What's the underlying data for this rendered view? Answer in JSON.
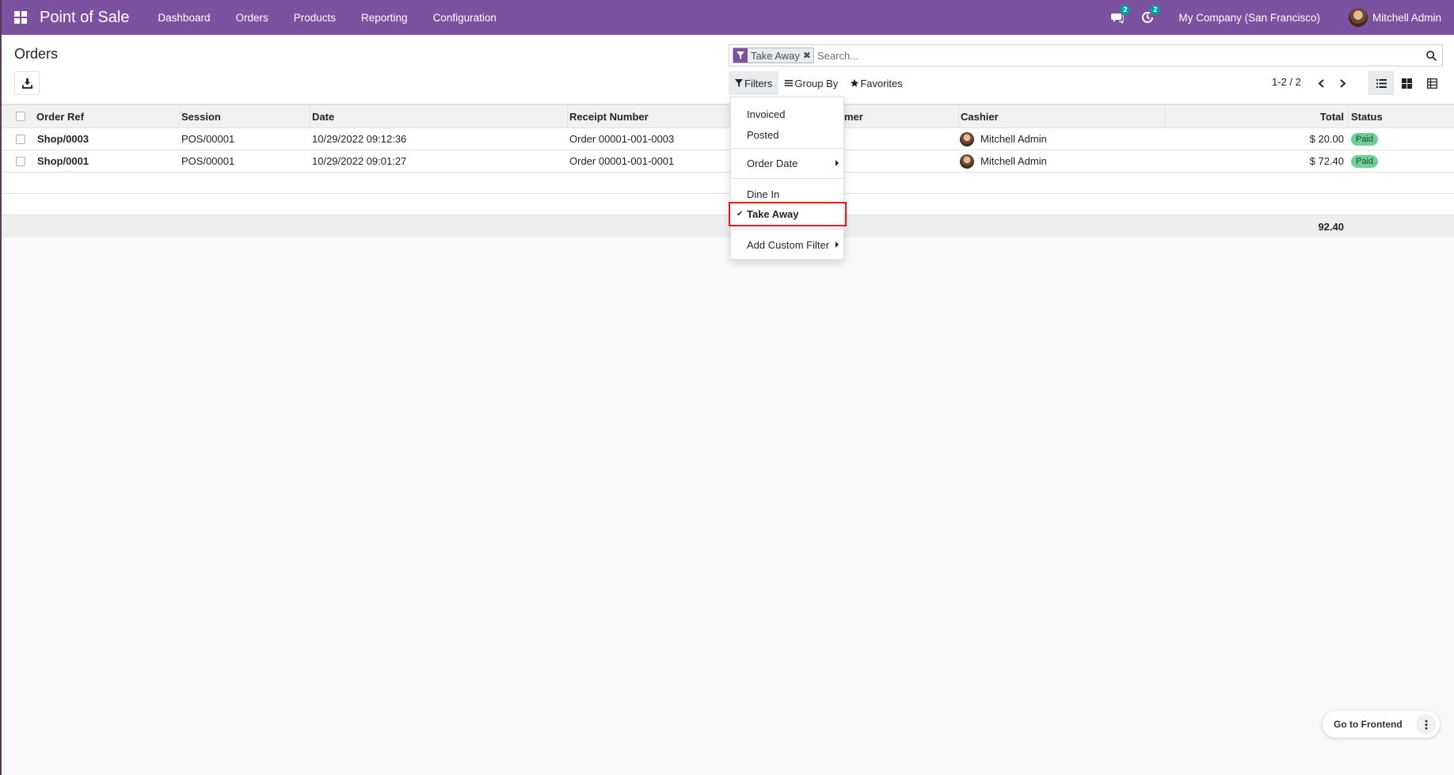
{
  "navbar": {
    "brand": "Point of Sale",
    "menu": [
      "Dashboard",
      "Orders",
      "Products",
      "Reporting",
      "Configuration"
    ],
    "messages_count": "2",
    "activities_count": "2",
    "company": "My Company (San Francisco)",
    "user": "Mitchell Admin",
    "color": "#7c52a0"
  },
  "control_panel": {
    "title": "Orders",
    "search": {
      "facet_label": "Take Away",
      "placeholder": "Search..."
    },
    "search_options": {
      "filters": "Filters",
      "group_by": "Group By",
      "favorites": "Favorites"
    },
    "pager": "1-2 / 2"
  },
  "filters_dropdown": {
    "items": [
      "Invoiced",
      "Posted",
      "Order Date",
      "Dine In",
      "Take Away",
      "Add Custom Filter"
    ],
    "selected": "Take Away"
  },
  "table": {
    "columns": [
      "Order Ref",
      "Session",
      "Date",
      "Receipt Number",
      "mer",
      "Cashier",
      "Total",
      "Status"
    ],
    "rows": [
      {
        "order_ref": "Shop/0003",
        "session": "POS/00001",
        "date": "10/29/2022 09:12:36",
        "receipt": "Order 00001-001-0003",
        "cashier": "Mitchell Admin",
        "total": "$ 20.00",
        "status": "Paid"
      },
      {
        "order_ref": "Shop/0001",
        "session": "POS/00001",
        "date": "10/29/2022 09:01:27",
        "receipt": "Order 00001-001-0001",
        "cashier": "Mitchell Admin",
        "total": "$ 72.40",
        "status": "Paid"
      }
    ],
    "footer_total": "92.40"
  },
  "bottom": {
    "go_to_frontend": "Go to Frontend"
  }
}
